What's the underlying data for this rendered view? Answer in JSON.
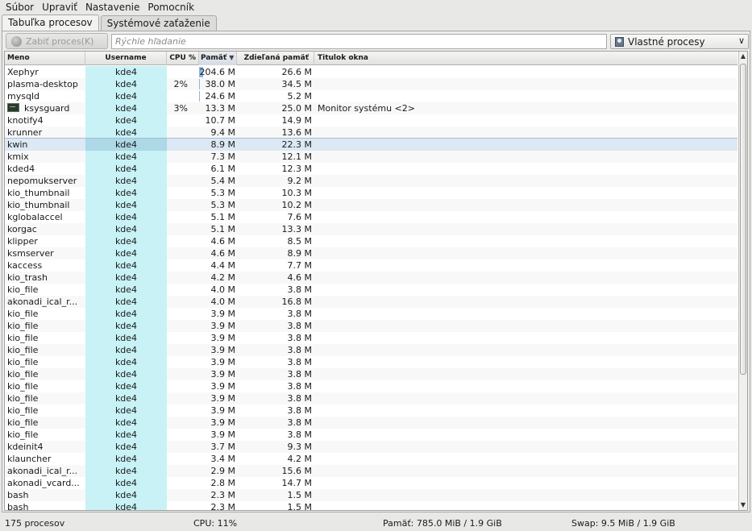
{
  "menubar": {
    "items": [
      "Súbor",
      "Upraviť",
      "Nastavenie",
      "Pomocník"
    ]
  },
  "tabs": [
    {
      "label": "Tabuľka procesov",
      "active": true
    },
    {
      "label": "Systémové zaťaženie",
      "active": false
    }
  ],
  "toolbar": {
    "kill_label": "Zabiť proces(K)",
    "search_placeholder": "Rýchle hľadanie",
    "filter_selected": "Vlastné procesy"
  },
  "table": {
    "columns": [
      "Meno",
      "Username",
      "CPU %",
      "Pamäť",
      "Zdieľaná pamäť",
      "Titulok okna"
    ],
    "sort_column": "Pamäť",
    "rows": [
      {
        "name": "Xephyr",
        "user": "kde4",
        "cpu": "",
        "mem": "204.6 M",
        "mem_mb": 204.6,
        "shared": "26.6 M",
        "title": ""
      },
      {
        "name": "plasma-desktop",
        "user": "kde4",
        "cpu": "2%",
        "mem": "38.0 M",
        "mem_mb": 38.0,
        "shared": "34.5 M",
        "title": ""
      },
      {
        "name": "mysqld",
        "user": "kde4",
        "cpu": "",
        "mem": "24.6 M",
        "mem_mb": 24.6,
        "shared": "5.2 M",
        "title": ""
      },
      {
        "name": "ksysguard",
        "user": "kde4",
        "cpu": "3%",
        "mem": "13.3 M",
        "mem_mb": 13.3,
        "shared": "25.0 M",
        "title": "Monitor systému <2>",
        "icon": "terminal-window-icon"
      },
      {
        "name": "knotify4",
        "user": "kde4",
        "cpu": "",
        "mem": "10.7 M",
        "mem_mb": 10.7,
        "shared": "14.9 M",
        "title": ""
      },
      {
        "name": "krunner",
        "user": "kde4",
        "cpu": "",
        "mem": "9.4 M",
        "mem_mb": 9.4,
        "shared": "13.6 M",
        "title": ""
      },
      {
        "name": "kwin",
        "user": "kde4",
        "cpu": "",
        "mem": "8.9 M",
        "mem_mb": 8.9,
        "shared": "22.3 M",
        "title": "",
        "selected": true
      },
      {
        "name": "kmix",
        "user": "kde4",
        "cpu": "",
        "mem": "7.3 M",
        "mem_mb": 7.3,
        "shared": "12.1 M",
        "title": ""
      },
      {
        "name": "kded4",
        "user": "kde4",
        "cpu": "",
        "mem": "6.1 M",
        "mem_mb": 6.1,
        "shared": "12.3 M",
        "title": ""
      },
      {
        "name": "nepomukserver",
        "user": "kde4",
        "cpu": "",
        "mem": "5.4 M",
        "mem_mb": 5.4,
        "shared": "9.2 M",
        "title": ""
      },
      {
        "name": "kio_thumbnail",
        "user": "kde4",
        "cpu": "",
        "mem": "5.3 M",
        "mem_mb": 5.3,
        "shared": "10.3 M",
        "title": ""
      },
      {
        "name": "kio_thumbnail",
        "user": "kde4",
        "cpu": "",
        "mem": "5.3 M",
        "mem_mb": 5.3,
        "shared": "10.2 M",
        "title": ""
      },
      {
        "name": "kglobalaccel",
        "user": "kde4",
        "cpu": "",
        "mem": "5.1 M",
        "mem_mb": 5.1,
        "shared": "7.6 M",
        "title": ""
      },
      {
        "name": "korgac",
        "user": "kde4",
        "cpu": "",
        "mem": "5.1 M",
        "mem_mb": 5.1,
        "shared": "13.3 M",
        "title": ""
      },
      {
        "name": "klipper",
        "user": "kde4",
        "cpu": "",
        "mem": "4.6 M",
        "mem_mb": 4.6,
        "shared": "8.5 M",
        "title": ""
      },
      {
        "name": "ksmserver",
        "user": "kde4",
        "cpu": "",
        "mem": "4.6 M",
        "mem_mb": 4.6,
        "shared": "8.9 M",
        "title": ""
      },
      {
        "name": "kaccess",
        "user": "kde4",
        "cpu": "",
        "mem": "4.4 M",
        "mem_mb": 4.4,
        "shared": "7.7 M",
        "title": ""
      },
      {
        "name": "kio_trash",
        "user": "kde4",
        "cpu": "",
        "mem": "4.2 M",
        "mem_mb": 4.2,
        "shared": "4.6 M",
        "title": ""
      },
      {
        "name": "kio_file",
        "user": "kde4",
        "cpu": "",
        "mem": "4.0 M",
        "mem_mb": 4.0,
        "shared": "3.8 M",
        "title": ""
      },
      {
        "name": "akonadi_ical_r...",
        "user": "kde4",
        "cpu": "",
        "mem": "4.0 M",
        "mem_mb": 4.0,
        "shared": "16.8 M",
        "title": ""
      },
      {
        "name": "kio_file",
        "user": "kde4",
        "cpu": "",
        "mem": "3.9 M",
        "mem_mb": 3.9,
        "shared": "3.8 M",
        "title": ""
      },
      {
        "name": "kio_file",
        "user": "kde4",
        "cpu": "",
        "mem": "3.9 M",
        "mem_mb": 3.9,
        "shared": "3.8 M",
        "title": ""
      },
      {
        "name": "kio_file",
        "user": "kde4",
        "cpu": "",
        "mem": "3.9 M",
        "mem_mb": 3.9,
        "shared": "3.8 M",
        "title": ""
      },
      {
        "name": "kio_file",
        "user": "kde4",
        "cpu": "",
        "mem": "3.9 M",
        "mem_mb": 3.9,
        "shared": "3.8 M",
        "title": ""
      },
      {
        "name": "kio_file",
        "user": "kde4",
        "cpu": "",
        "mem": "3.9 M",
        "mem_mb": 3.9,
        "shared": "3.8 M",
        "title": ""
      },
      {
        "name": "kio_file",
        "user": "kde4",
        "cpu": "",
        "mem": "3.9 M",
        "mem_mb": 3.9,
        "shared": "3.8 M",
        "title": ""
      },
      {
        "name": "kio_file",
        "user": "kde4",
        "cpu": "",
        "mem": "3.9 M",
        "mem_mb": 3.9,
        "shared": "3.8 M",
        "title": ""
      },
      {
        "name": "kio_file",
        "user": "kde4",
        "cpu": "",
        "mem": "3.9 M",
        "mem_mb": 3.9,
        "shared": "3.8 M",
        "title": ""
      },
      {
        "name": "kio_file",
        "user": "kde4",
        "cpu": "",
        "mem": "3.9 M",
        "mem_mb": 3.9,
        "shared": "3.8 M",
        "title": ""
      },
      {
        "name": "kio_file",
        "user": "kde4",
        "cpu": "",
        "mem": "3.9 M",
        "mem_mb": 3.9,
        "shared": "3.8 M",
        "title": ""
      },
      {
        "name": "kio_file",
        "user": "kde4",
        "cpu": "",
        "mem": "3.9 M",
        "mem_mb": 3.9,
        "shared": "3.8 M",
        "title": ""
      },
      {
        "name": "kdeinit4",
        "user": "kde4",
        "cpu": "",
        "mem": "3.7 M",
        "mem_mb": 3.7,
        "shared": "9.3 M",
        "title": ""
      },
      {
        "name": "klauncher",
        "user": "kde4",
        "cpu": "",
        "mem": "3.4 M",
        "mem_mb": 3.4,
        "shared": "4.2 M",
        "title": ""
      },
      {
        "name": "akonadi_ical_r...",
        "user": "kde4",
        "cpu": "",
        "mem": "2.9 M",
        "mem_mb": 2.9,
        "shared": "15.6 M",
        "title": ""
      },
      {
        "name": "akonadi_vcard...",
        "user": "kde4",
        "cpu": "",
        "mem": "2.8 M",
        "mem_mb": 2.8,
        "shared": "14.7 M",
        "title": ""
      },
      {
        "name": "bash",
        "user": "kde4",
        "cpu": "",
        "mem": "2.3 M",
        "mem_mb": 2.3,
        "shared": "1.5 M",
        "title": ""
      },
      {
        "name": "bash",
        "user": "kde4",
        "cpu": "",
        "mem": "2.3 M",
        "mem_mb": 2.3,
        "shared": "1.5 M",
        "title": ""
      }
    ]
  },
  "statusbar": {
    "processes": "175 procesov",
    "cpu": "CPU: 11%",
    "memory": "Pamäť: 785.0 MiB / 1.9 GiB",
    "swap": "Swap: 9.5 MiB / 1.9 GiB"
  },
  "colors": {
    "user_cell": "#c8f2f6",
    "mem_bar": "#8fb6dc",
    "selection": "#dde8f5"
  }
}
